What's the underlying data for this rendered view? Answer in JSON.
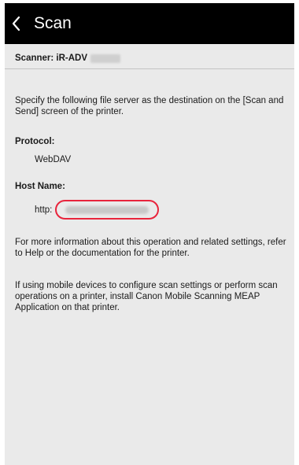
{
  "header": {
    "title": "Scan",
    "back_icon": "chevron-left-icon"
  },
  "scanner": {
    "label": "Scanner: iR-ADV"
  },
  "instructions": {
    "text": "Specify the following file server as the destination on the [Scan and Send] screen of the printer."
  },
  "protocol": {
    "label": "Protocol:",
    "value": "WebDAV"
  },
  "host": {
    "label": "Host Name:",
    "prefix": "http:",
    "highlight_color": "#e8243c"
  },
  "info": {
    "text": "For more information about this operation and related settings, refer to Help or the documentation for the printer."
  },
  "mobile": {
    "text": "If using mobile devices to configure scan settings or perform scan operations on a printer, install Canon Mobile Scanning MEAP Application on that printer."
  }
}
